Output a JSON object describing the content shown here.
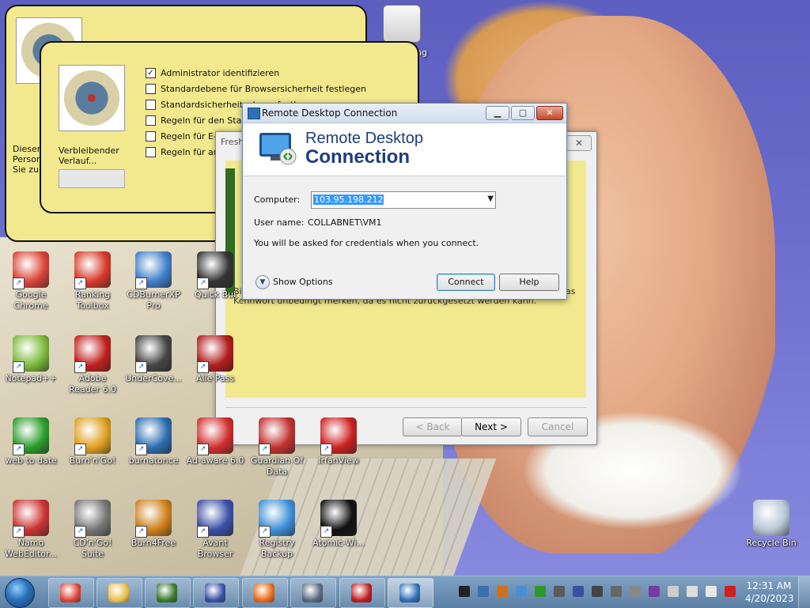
{
  "security_panel": {
    "items": [
      {
        "label": "Administrator identifizieren",
        "checked": true
      },
      {
        "label": "Standardebene für Browsersicherheit festlegen",
        "checked": false
      },
      {
        "label": "Standardsicherheitsebene festlegen",
        "checked": false
      },
      {
        "label": "Regeln für den Standa",
        "checked": false
      },
      {
        "label": "Regeln für E-M",
        "checked": false
      },
      {
        "label": "Regeln für and",
        "checked": false
      }
    ],
    "remaining_label_line1": "Verbleibender",
    "remaining_label_line2": "Verlauf...",
    "back_text_line1": "Dieser",
    "back_text_line2": "Person",
    "back_text_line3": "Sie zun"
  },
  "wizard": {
    "title": "Fresh",
    "body_line1": "Bit",
    "body_line1_end": "as",
    "body_line2": "Kennwort unbedingt merken, da es nicht zurückgesetzt werden kann.",
    "back_button": "< Back",
    "next_button": "Next >",
    "cancel_button": "Cancel"
  },
  "rdp": {
    "window_title": "Remote Desktop Connection",
    "heading_line1": "Remote Desktop",
    "heading_line2": "Connection",
    "computer_label": "Computer:",
    "computer_value": "103.95.198.212",
    "username_label": "User name:",
    "username_value": "COLLABNET\\VM1",
    "info_text": "You will be asked for credentials when you connect.",
    "show_options": "Show Options",
    "connect_button": "Connect",
    "help_button": "Help"
  },
  "desktop_icons": [
    {
      "label": "Google Chrome",
      "icon": "chrome-icon",
      "color": "#db4437"
    },
    {
      "label": "Ranking Toolbox",
      "icon": "ranking-toolbox-icon",
      "color": "#d83a2a"
    },
    {
      "label": "CDBurnerXP Pro",
      "icon": "cdburnerxp-icon",
      "color": "#3f7fc9"
    },
    {
      "label": "Quick Bui",
      "icon": "qr-icon",
      "color": "#333333"
    },
    {
      "label": "Notepad++",
      "icon": "notepadpp-icon",
      "color": "#7dbb3c"
    },
    {
      "label": "Adobe Reader 6.0",
      "icon": "adobe-reader-icon",
      "color": "#c0211e"
    },
    {
      "label": "UnderCove...",
      "icon": "undercover-icon",
      "color": "#444444"
    },
    {
      "label": "Alle Pass",
      "icon": "password-icon",
      "color": "#b21b1b"
    },
    {
      "label": "web to date",
      "icon": "webtodate-icon",
      "color": "#2d9d2d"
    },
    {
      "label": "Burn'n'Go!",
      "icon": "burnngo-icon",
      "color": "#e0a020"
    },
    {
      "label": "burnatonce",
      "icon": "burnatonce-icon",
      "color": "#2c6db0"
    },
    {
      "label": "Ad-aware 6.0",
      "icon": "adaware-icon",
      "color": "#d12e2e"
    },
    {
      "label": "Guardian Of Data",
      "icon": "guardian-icon",
      "color": "#c23030"
    },
    {
      "label": "IrfanView",
      "icon": "irfanview-icon",
      "color": "#cc2020"
    },
    {
      "label": "Namo WebEditor...",
      "icon": "namo-icon",
      "color": "#cc3333"
    },
    {
      "label": "CD'n'Go! Suite",
      "icon": "cdngo-icon",
      "color": "#777777"
    },
    {
      "label": "Burn4Free",
      "icon": "burn4free-icon",
      "color": "#d0801a"
    },
    {
      "label": "Avant Browser",
      "icon": "avant-icon",
      "color": "#3a50a8"
    },
    {
      "label": "Registry Backup",
      "icon": "registry-backup-icon",
      "color": "#3e8fd8"
    },
    {
      "label": "Atomic-Wi...",
      "icon": "atomic-icon",
      "color": "#111111"
    },
    {
      "label": "Recycle Bin",
      "icon": "recycle-bin-icon",
      "color": "#b8c8d8"
    }
  ],
  "top_icon_label": "ng",
  "taskbar": {
    "items": [
      {
        "name": "chrome",
        "icon": "chrome-icon",
        "color": "#db4437"
      },
      {
        "name": "explorer",
        "icon": "folder-icon",
        "color": "#e8c050"
      },
      {
        "name": "checklist",
        "icon": "checklist-icon",
        "color": "#3a7a2a"
      },
      {
        "name": "avant",
        "icon": "avant-icon",
        "color": "#3a50a8"
      },
      {
        "name": "firefox",
        "icon": "firefox-icon",
        "color": "#e86a1a"
      },
      {
        "name": "setup",
        "icon": "installer-icon",
        "color": "#5a6a80"
      },
      {
        "name": "monitor",
        "icon": "monitor-icon",
        "color": "#c02020"
      },
      {
        "name": "rdp",
        "icon": "remote-desktop-icon",
        "color": "#2f6fb8"
      }
    ],
    "time": "12:31 AM",
    "date": "4/20/2023"
  }
}
